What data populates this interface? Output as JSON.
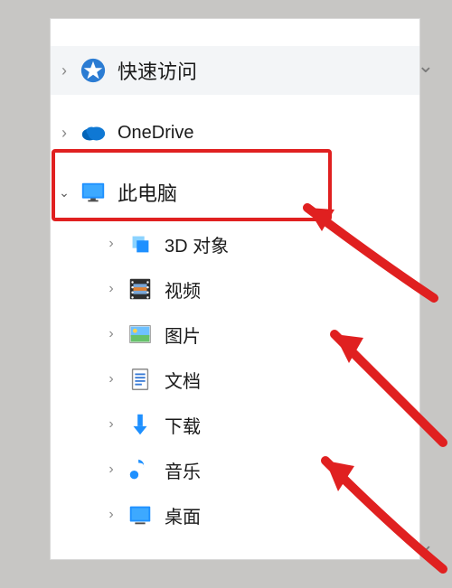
{
  "sidebar": {
    "quick_access": {
      "label": "快速访问",
      "expanded": false
    },
    "onedrive": {
      "label": "OneDrive",
      "expanded": false
    },
    "this_pc": {
      "label": "此电脑",
      "expanded": true,
      "children": [
        {
          "key": "3d_objects",
          "label": "3D 对象"
        },
        {
          "key": "videos",
          "label": "视频"
        },
        {
          "key": "pictures",
          "label": "图片"
        },
        {
          "key": "documents",
          "label": "文档"
        },
        {
          "key": "downloads",
          "label": "下载"
        },
        {
          "key": "music",
          "label": "音乐"
        },
        {
          "key": "desktop",
          "label": "桌面"
        }
      ]
    }
  },
  "annotation": {
    "highlight": "this_pc",
    "arrow_color": "#e02020"
  }
}
